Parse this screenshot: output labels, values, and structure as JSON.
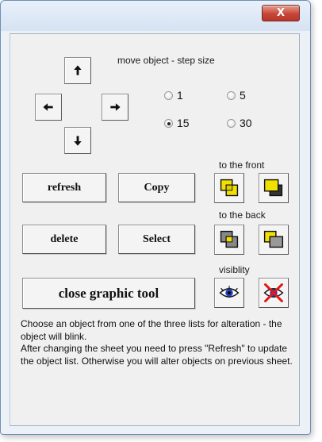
{
  "window": {
    "close_label": "X"
  },
  "move": {
    "heading": "move object - step size",
    "step_options": [
      {
        "label": "1",
        "selected": false
      },
      {
        "label": "5",
        "selected": false
      },
      {
        "label": "15",
        "selected": true
      },
      {
        "label": "30",
        "selected": false
      }
    ]
  },
  "buttons": {
    "refresh": "refresh",
    "copy": "Copy",
    "delete": "delete",
    "select": "Select",
    "close_tool": "close graphic tool"
  },
  "sections": {
    "front": "to the front",
    "back": "to the back",
    "visibility": "visiblity"
  },
  "help_text": "Choose an object from one of the three lists for alteration - the object will blink.\nAfter changing the sheet you need to press \"Refresh\" to update the object list. Otherwise you will alter objects on previous sheet.",
  "colors": {
    "accent_yellow": "#f2e000",
    "close_red": "#c8453a",
    "eye_blue": "#1f3fbf"
  }
}
